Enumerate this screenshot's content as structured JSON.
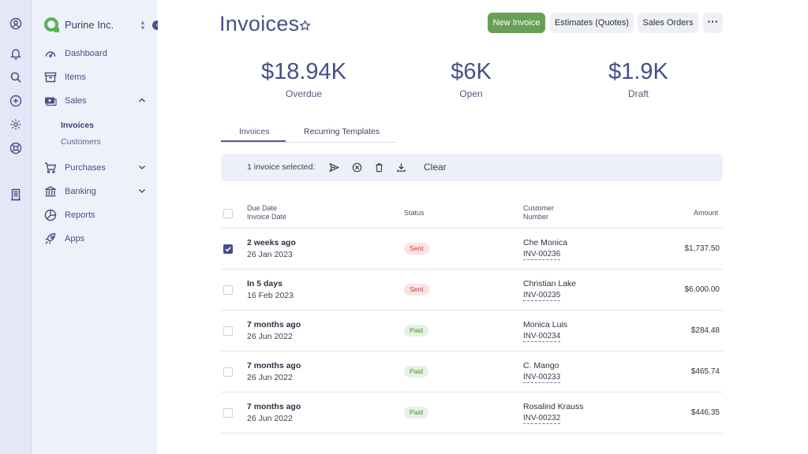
{
  "rail": {
    "icons": [
      "user-circle-icon",
      "bell-icon",
      "search-icon",
      "plus-circle-icon",
      "gear-icon",
      "help-buoy-icon",
      "document-icon"
    ]
  },
  "sidebar": {
    "org_name": "Purine Inc.",
    "items": [
      {
        "label": "Dashboard",
        "icon": "gauge-icon"
      },
      {
        "label": "Items",
        "icon": "archive-icon"
      },
      {
        "label": "Sales",
        "icon": "money-icon",
        "expanded": true,
        "children": [
          {
            "label": "Invoices",
            "active": true
          },
          {
            "label": "Customers"
          }
        ]
      },
      {
        "label": "Purchases",
        "icon": "cart-icon",
        "expanded": false
      },
      {
        "label": "Banking",
        "icon": "bank-icon",
        "expanded": false
      },
      {
        "label": "Reports",
        "icon": "pie-chart-icon"
      },
      {
        "label": "Apps",
        "icon": "rocket-icon"
      }
    ]
  },
  "header": {
    "title": "Invoices",
    "buttons": {
      "new_invoice": "New Invoice",
      "estimates": "Estimates (Quotes)",
      "sales_orders": "Sales Orders"
    }
  },
  "stats": [
    {
      "value": "$18.94K",
      "label": "Overdue"
    },
    {
      "value": "$6K",
      "label": "Open"
    },
    {
      "value": "$1.9K",
      "label": "Draft"
    }
  ],
  "tabs": [
    {
      "label": "Invoices",
      "active": true
    },
    {
      "label": "Recurring Templates",
      "active": false
    }
  ],
  "selection": {
    "text": "1 invoice selected:",
    "clear": "Clear"
  },
  "table": {
    "headers": {
      "due_date": "Due Date",
      "invoice_date": "Invoice Date",
      "status": "Status",
      "customer": "Customer",
      "number": "Number",
      "amount": "Amount"
    },
    "rows": [
      {
        "checked": true,
        "due": "2 weeks ago",
        "date": "26 Jan 2023",
        "status": "Sent",
        "customer": "Che Monica",
        "number": "INV-00236",
        "amount": "$1,737.50"
      },
      {
        "checked": false,
        "due": "In 5 days",
        "date": "16 Feb 2023",
        "status": "Sent",
        "customer": "Christian Lake",
        "number": "INV-00235",
        "amount": "$6,000.00"
      },
      {
        "checked": false,
        "due": "7 months ago",
        "date": "26 Jun 2022",
        "status": "Paid",
        "customer": "Monica Luis",
        "number": "INV-00234",
        "amount": "$284.48"
      },
      {
        "checked": false,
        "due": "7 months ago",
        "date": "26 Jun 2022",
        "status": "Paid",
        "customer": "C. Mango",
        "number": "INV-00233",
        "amount": "$465.74"
      },
      {
        "checked": false,
        "due": "7 months ago",
        "date": "26 Jun 2022",
        "status": "Paid",
        "customer": "Rosalind Krauss",
        "number": "INV-00232",
        "amount": "$446.35"
      }
    ]
  },
  "colors": {
    "accent": "#4a4e88",
    "primary_button": "#67a055",
    "sent_badge": "#c0403f",
    "paid_badge": "#4f8a45"
  }
}
